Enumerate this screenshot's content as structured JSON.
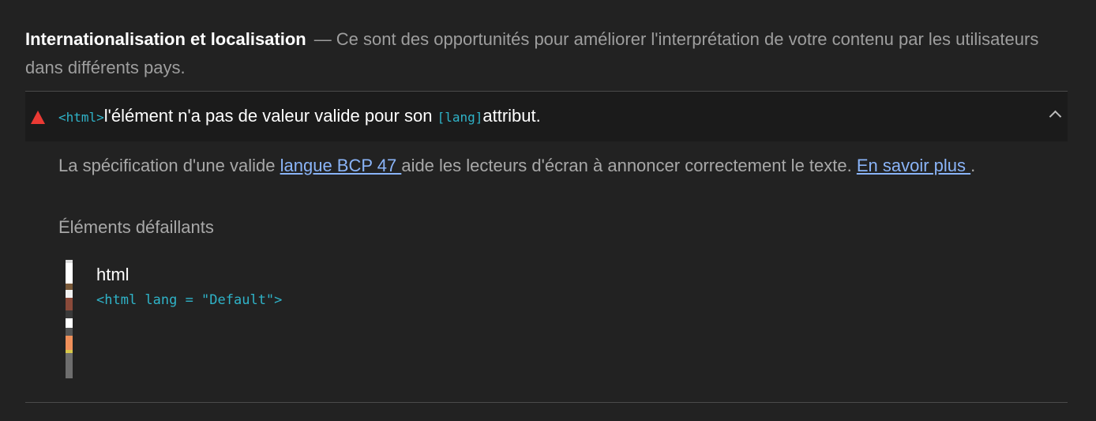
{
  "group": {
    "title": "Internationalisation et localisation",
    "separator": "—",
    "description": "Ce sont des opportunités pour améliorer l'interprétation de votre contenu par les utilisateurs dans différents pays."
  },
  "audit": {
    "status_icon": "fail-triangle-icon",
    "status_color": "#eb3a34",
    "title_code_html": "<html>",
    "title_text_1": "l'élément n'a pas de valeur valide pour son ",
    "title_code_lang": "[lang]",
    "title_text_2": "attribut.",
    "expand_icon": "chevron-up-icon",
    "description_before": "La spécification d'une valide ",
    "description_link": "langue BCP 47 ",
    "description_middle": "aide les lecteurs d'écran à annoncer correctement le texte. ",
    "learn_more": "En savoir plus ",
    "description_end": "."
  },
  "failing": {
    "label": "Éléments défaillants",
    "items": [
      {
        "node": "html",
        "snippet": "<html lang = \"Default\">"
      }
    ]
  },
  "colors": {
    "background": "#222222",
    "row_background": "#1b1b1b",
    "link": "#8ab4f8",
    "code": "#2fb3c8"
  }
}
